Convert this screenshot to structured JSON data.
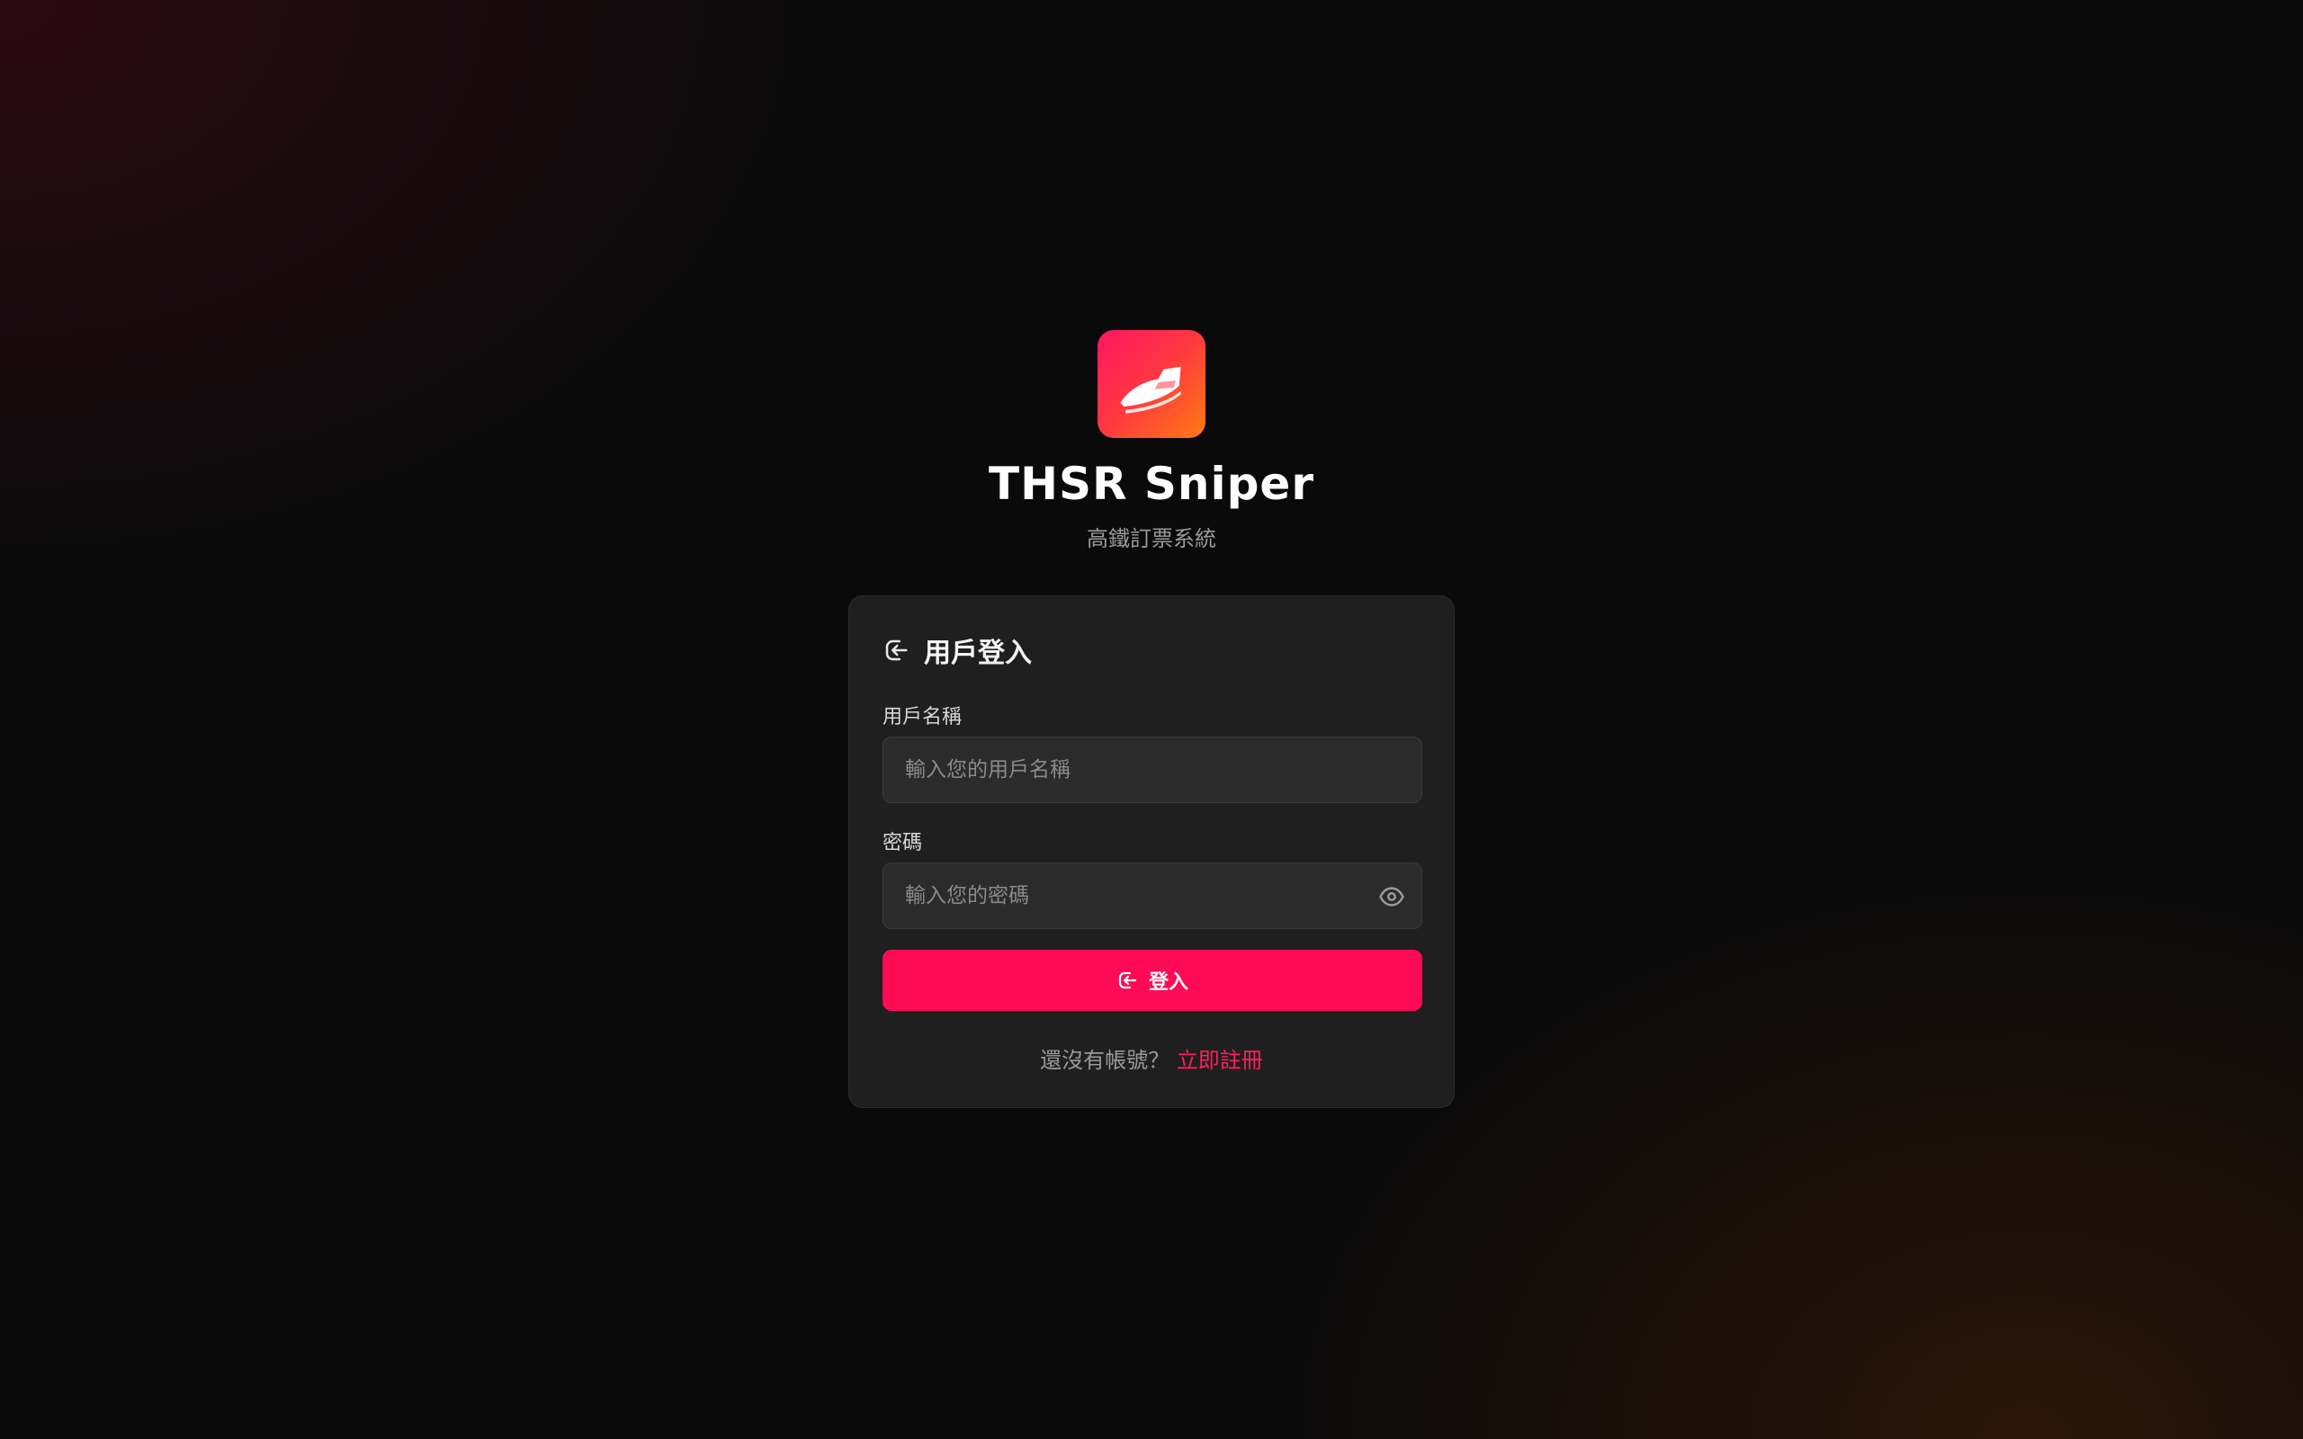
{
  "app": {
    "title": "THSR Sniper",
    "subtitle": "高鐵訂票系統"
  },
  "login_card": {
    "title": "用戶登入",
    "username": {
      "label": "用戶名稱",
      "placeholder": "輸入您的用戶名稱",
      "value": ""
    },
    "password": {
      "label": "密碼",
      "placeholder": "輸入您的密碼",
      "value": ""
    },
    "submit_label": "登入",
    "signup_prompt": "還沒有帳號？",
    "signup_link": "立即註冊"
  },
  "icons": {
    "logo": "train-icon",
    "header": "login-icon",
    "password_toggle": "eye-icon",
    "submit": "login-icon"
  },
  "colors": {
    "accent": "#ff0a54",
    "link": "#ff1f5e",
    "background": "#0a0a0a",
    "card": "#1f1f1f",
    "logo_gradient_start": "#ff1560",
    "logo_gradient_end": "#ff7a10"
  }
}
